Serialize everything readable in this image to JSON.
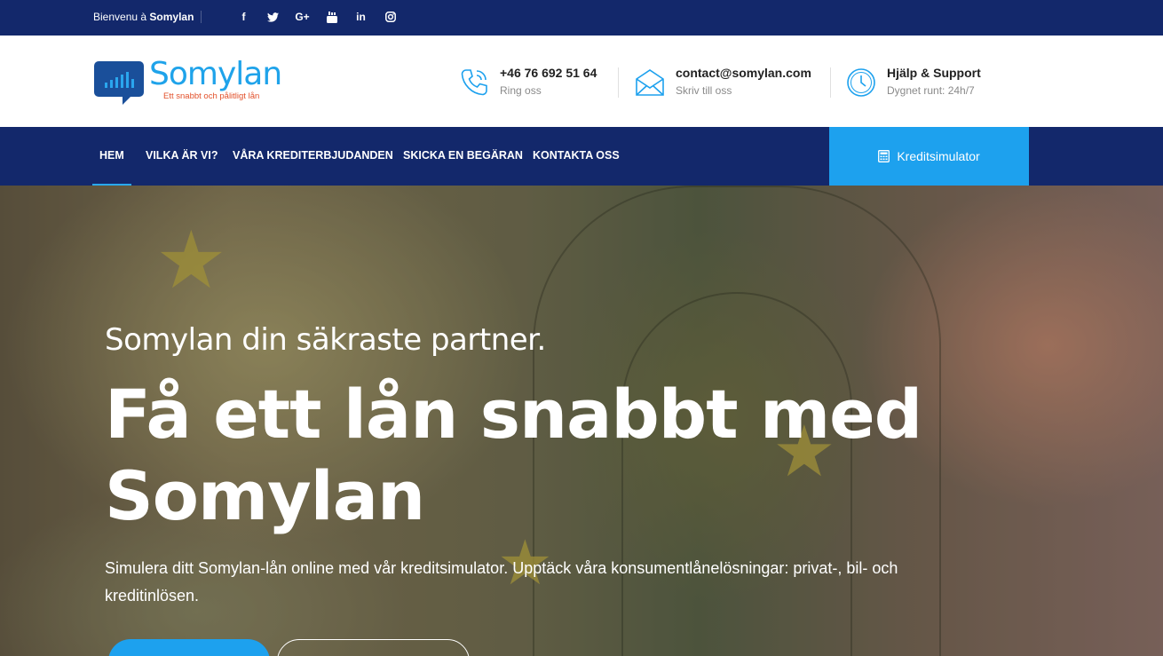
{
  "topbar": {
    "welcome_prefix": "Bienvenu à",
    "welcome_brand": "Somylan",
    "socials": [
      {
        "icon": "facebook-icon",
        "glyph": "f"
      },
      {
        "icon": "twitter-icon",
        "glyph": "🐦"
      },
      {
        "icon": "google-plus-icon",
        "glyph": "G+"
      },
      {
        "icon": "youtube-icon",
        "glyph": "▶"
      },
      {
        "icon": "linkedin-icon",
        "glyph": "in"
      },
      {
        "icon": "instagram-icon",
        "glyph": "◎"
      }
    ]
  },
  "header": {
    "logo": {
      "name": "Somylan",
      "tagline": "Ett snabbt och pålitligt lån"
    },
    "contacts": [
      {
        "icon": "phone-icon",
        "title": "+46 76 692 51 64",
        "sub": "Ring oss"
      },
      {
        "icon": "envelope-icon",
        "title": "contact@somylan.com",
        "sub": "Skriv till oss"
      },
      {
        "icon": "clock-icon",
        "title": "Hjälp & Support",
        "sub": "Dygnet runt: 24h/7"
      }
    ]
  },
  "nav": {
    "items": [
      {
        "label": "HEM",
        "active": true
      },
      {
        "label": "VILKA ÄR VI?"
      },
      {
        "label": "VÅRA KREDITERBJUDANDEN"
      },
      {
        "label": "SKICKA EN BEGÄRAN"
      },
      {
        "label": "KONTAKTA OSS"
      }
    ],
    "simulator_button": {
      "label": "Kreditsimulator",
      "icon": "calculator-icon"
    }
  },
  "hero": {
    "pretitle": "Somylan din säkraste partner.",
    "title": "Få ett lån snabbt med Somylan",
    "description": "Simulera ditt Somylan-lån online med vår kreditsimulator. Upptäck våra konsumentlånelösningar: privat-, bil- och kreditinlösen."
  },
  "colors": {
    "navy": "#13286b",
    "accent": "#1da1ee",
    "logo_orange": "#e2502a"
  }
}
